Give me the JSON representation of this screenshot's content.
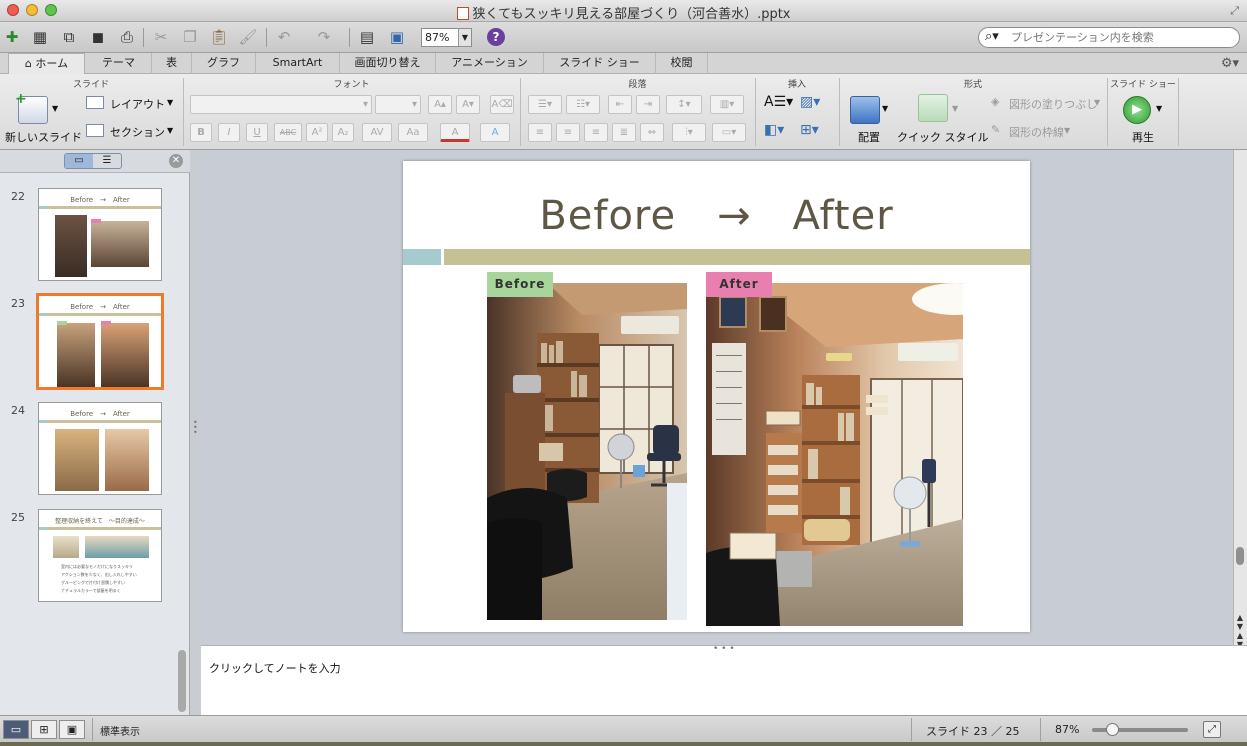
{
  "window": {
    "title": "狭くてもスッキリ見える部屋づくり（河合善水）.pptx",
    "traffic_lights": {
      "close": "#ee5c54",
      "minimize": "#f7bd32",
      "zoom": "#5cc64b"
    }
  },
  "toolbar": {
    "zoom_value": "87%",
    "search_placeholder": "プレゼンテーション内を検索"
  },
  "ribbon_tabs": [
    {
      "label": "ホーム",
      "active": true
    },
    {
      "label": "テーマ",
      "active": false
    },
    {
      "label": "表",
      "active": false
    },
    {
      "label": "グラフ",
      "active": false
    },
    {
      "label": "SmartArt",
      "active": false
    },
    {
      "label": "画面切り替え",
      "active": false
    },
    {
      "label": "アニメーション",
      "active": false
    },
    {
      "label": "スライド ショー",
      "active": false
    },
    {
      "label": "校閲",
      "active": false
    }
  ],
  "ribbon": {
    "groups": {
      "slide": "スライド",
      "font": "フォント",
      "paragraph": "段落",
      "insert": "挿入",
      "format": "形式",
      "slideshow": "スライド ショー"
    },
    "new_slide": "新しいスライド",
    "layout": "レイアウト",
    "section": "セクション",
    "arrange": "配置",
    "quick_style": "クイック スタイル",
    "shape_fill": "図形の塗りつぶし",
    "shape_outline": "図形の枠線",
    "play": "再生",
    "font_buttons": [
      "B",
      "I",
      "U",
      "ABC",
      "A²",
      "A₂",
      "AV",
      "Aa",
      "A",
      "A"
    ],
    "accent_color": "#ee7b2c"
  },
  "slides_panel": {
    "thumbnails": [
      {
        "number": "22",
        "title": "Before　→　After",
        "selected": false
      },
      {
        "number": "23",
        "title": "Before　→　After",
        "selected": true
      },
      {
        "number": "24",
        "title": "Before　→　After",
        "selected": false
      },
      {
        "number": "25",
        "title": "整理収納を終えて　～目的達成～",
        "selected": false,
        "bullets": [
          "室内には必要なモノだけになりスッキリ",
          "アクション数を少なく、出し入れしやすい",
          "グルーピングで片付け習慣しやすい",
          "ナチュラルカラーで部屋を明るく"
        ]
      }
    ]
  },
  "slide": {
    "title": "Before　→　After",
    "before_label": "Before",
    "after_label": "After",
    "colors": {
      "title": "#5f5746",
      "bar_left": "#a6cbcf",
      "bar_right": "#c6c095",
      "before_tag": "#a8d59c",
      "after_tag": "#e97fb0"
    }
  },
  "notes": {
    "placeholder": "クリックしてノートを入力"
  },
  "status": {
    "mode": "標準表示",
    "slide_indicator": "スライド 23 ／ 25",
    "zoom": "87%"
  }
}
